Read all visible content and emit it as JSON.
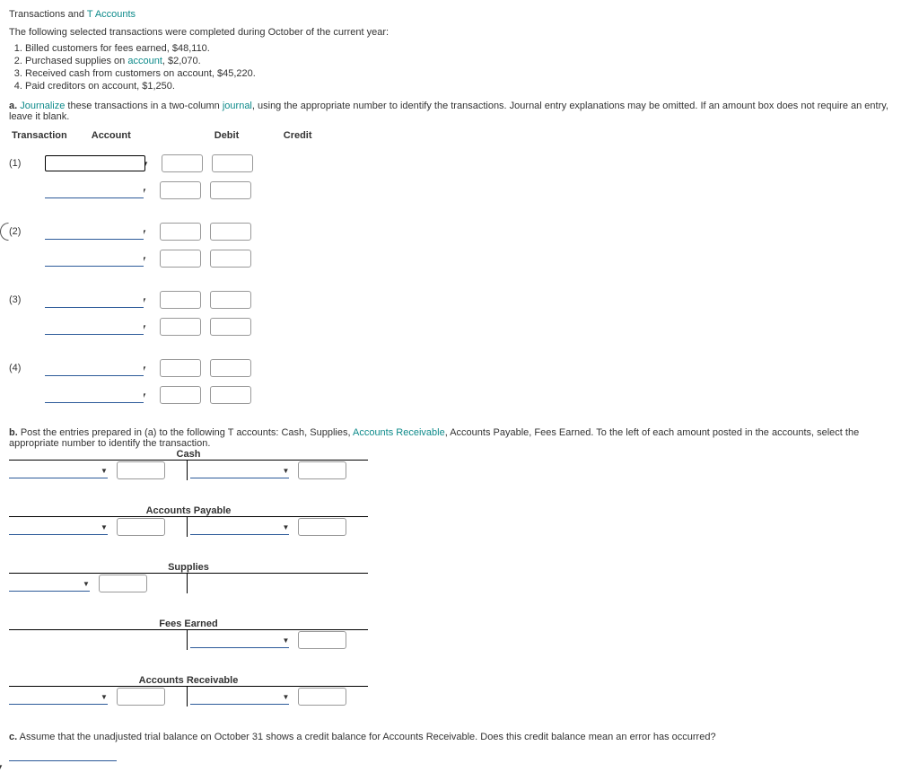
{
  "title": {
    "prefix": "Transactions and ",
    "link": "T Accounts"
  },
  "intro": "The following selected transactions were completed during October of the current year:",
  "transactions": [
    "Billed customers for fees earned, $48,110.",
    {
      "pre": "Purchased supplies on ",
      "link": "account",
      "post": ", $2,070."
    },
    "Received cash from customers on account, $45,220.",
    "Paid creditors on account, $1,250."
  ],
  "section_a": {
    "prefix": "a. ",
    "link1": "Journalize",
    "mid": " these transactions in a two-column ",
    "link2": "journal",
    "post": ", using the appropriate number to identify the transactions. Journal entry explanations may be omitted. If an amount box does not require an entry, leave it blank."
  },
  "headers": {
    "transaction": "Transaction",
    "account": "Account",
    "debit": "Debit",
    "credit": "Credit"
  },
  "rows": [
    "(1)",
    "(2)",
    "(3)",
    "(4)"
  ],
  "section_b": {
    "prefix": "b.",
    "text": "  Post the entries prepared in (a) to the following T accounts: Cash, Supplies, ",
    "link": "Accounts Receivable",
    "post": ", Accounts Payable, Fees Earned. To the left of each amount posted in the accounts, select the appropriate number to identify the transaction."
  },
  "t_accounts": {
    "cash": "Cash",
    "ap": "Accounts Payable",
    "supplies": "Supplies",
    "fees": "Fees Earned",
    "ar": "Accounts Receivable"
  },
  "section_c": {
    "prefix": "c.",
    "text": " Assume that the unadjusted trial balance on October 31 shows a credit balance for Accounts Receivable. Does this credit balance mean an error has occurred?"
  }
}
